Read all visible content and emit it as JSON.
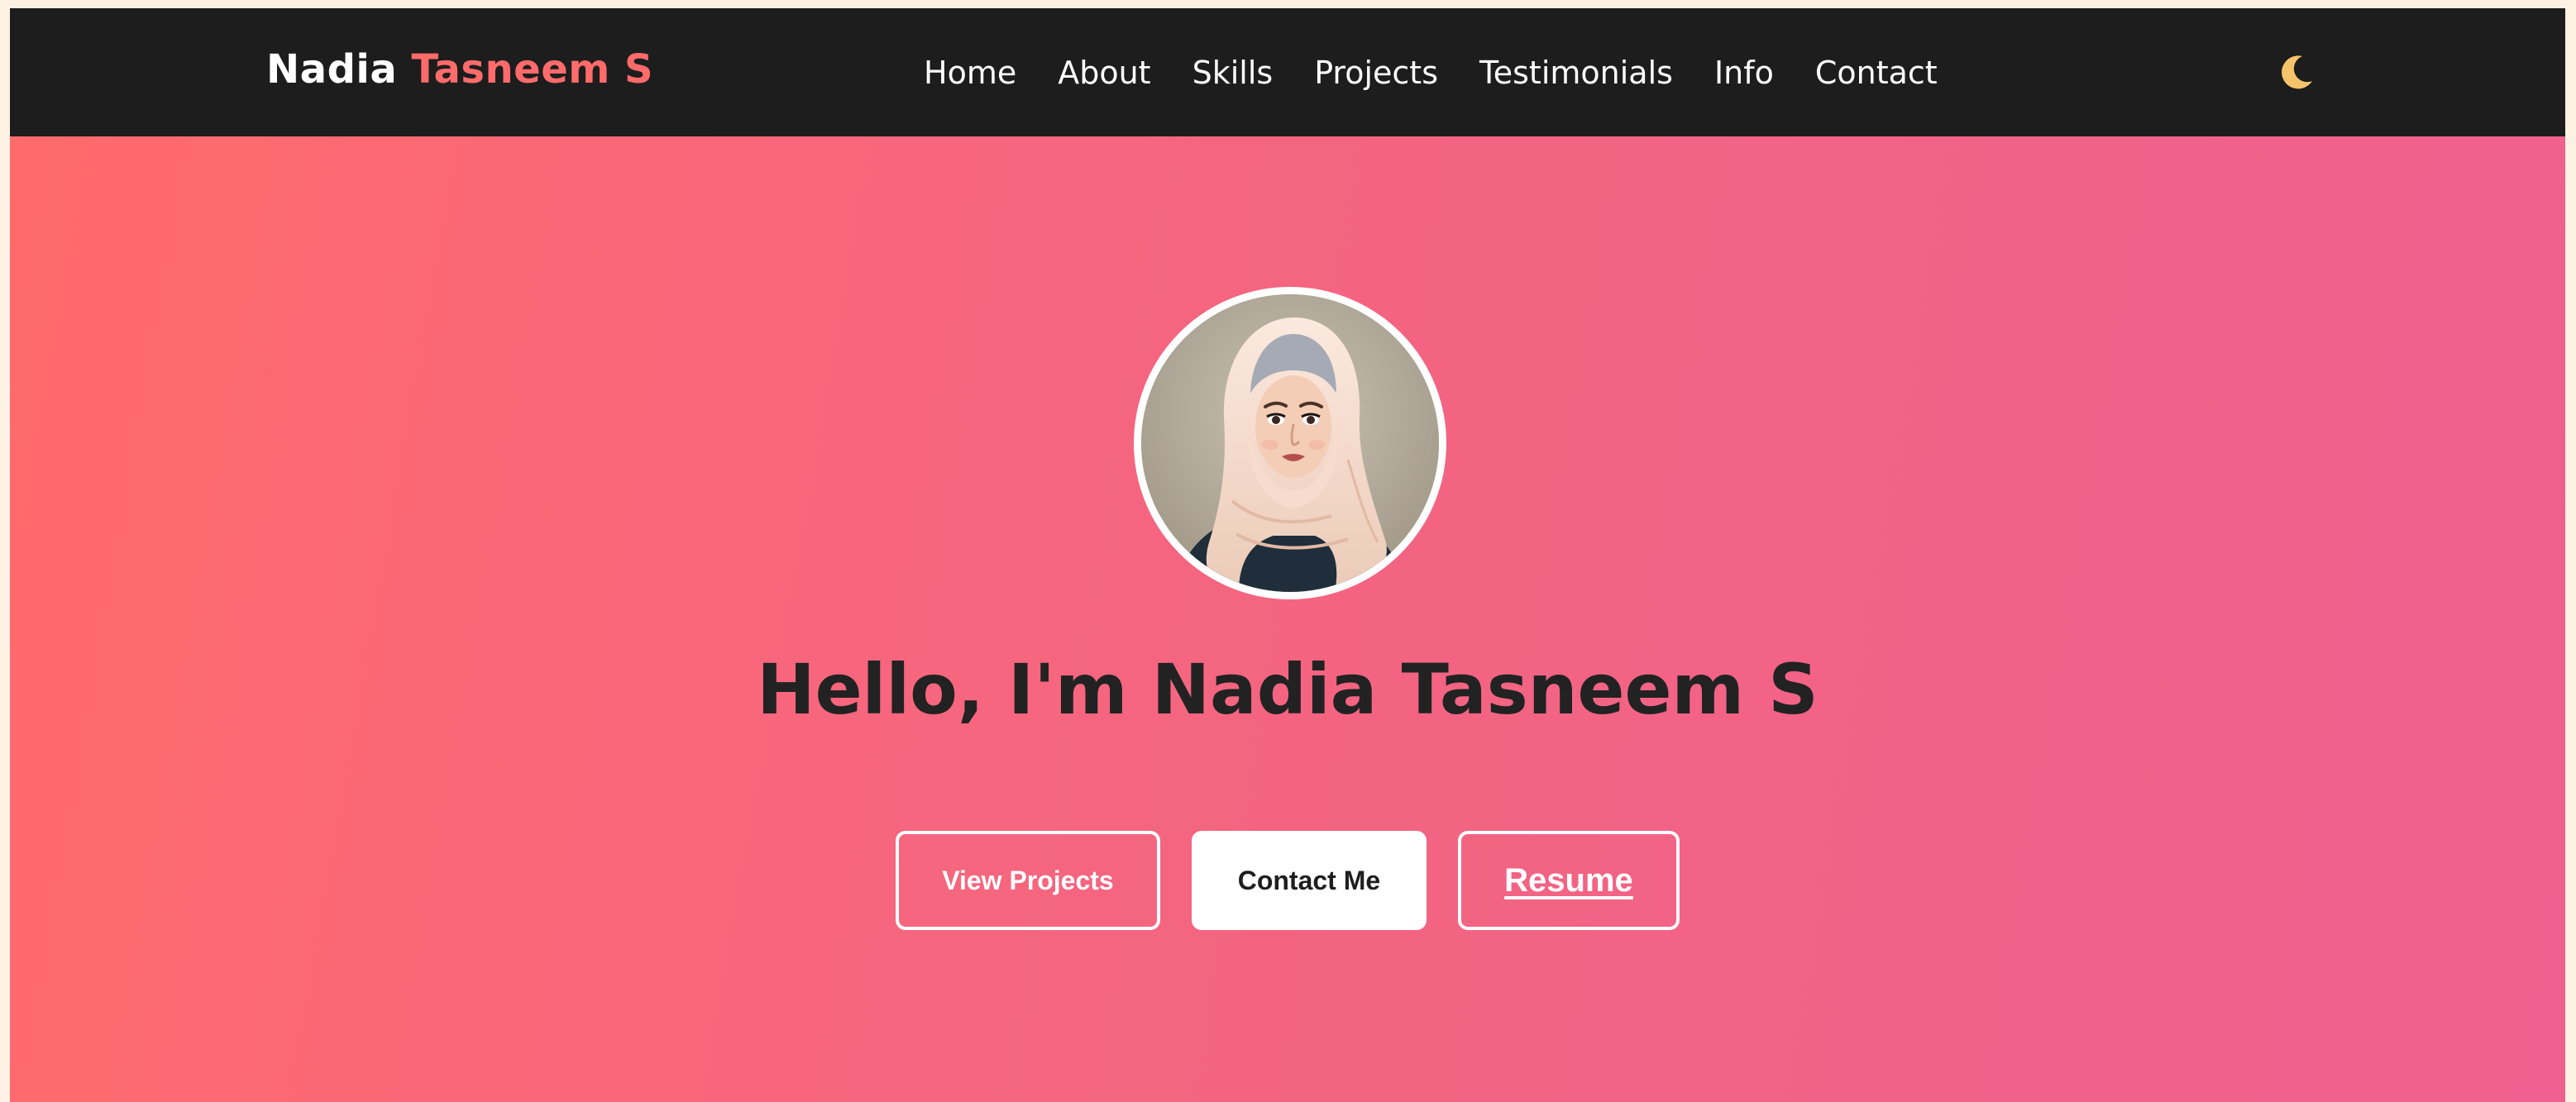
{
  "nav": {
    "brand_first": "Nadia",
    "brand_accent": "Tasneem S",
    "links": [
      "Home",
      "About",
      "Skills",
      "Projects",
      "Testimonials",
      "Info",
      "Contact"
    ],
    "theme_toggle": "moon-icon"
  },
  "hero": {
    "avatar": "hijab-woman-avatar-illustration",
    "headline": "Hello, I'm Nadia Tasneem S",
    "buttons": {
      "view_projects": "View Projects",
      "contact_me": "Contact Me",
      "resume": "Resume"
    }
  },
  "colors": {
    "navbar": "#1d1d1d",
    "accent": "#ff6b6b",
    "gradient_start": "#ff6b6b",
    "gradient_end": "#ef6090",
    "headline": "#222222",
    "moon": "#f5c46a"
  }
}
